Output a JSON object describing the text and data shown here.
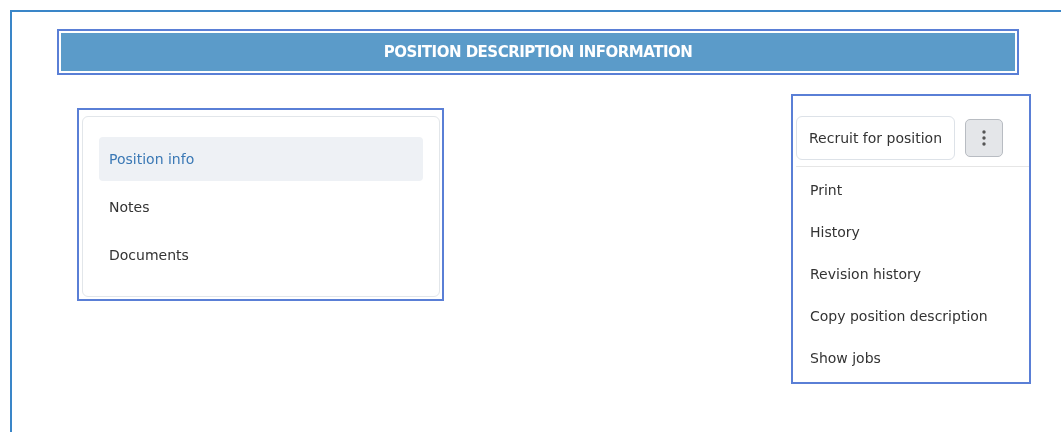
{
  "header": {
    "title": "POSITION DESCRIPTION INFORMATION"
  },
  "nav": {
    "items": [
      {
        "label": "Position info",
        "selected": true
      },
      {
        "label": "Notes",
        "selected": false
      },
      {
        "label": "Documents",
        "selected": false
      }
    ]
  },
  "actions": {
    "primary": "Recruit for position",
    "menu_items": [
      "Print",
      "History",
      "Revision history",
      "Copy position description",
      "Show jobs"
    ]
  }
}
